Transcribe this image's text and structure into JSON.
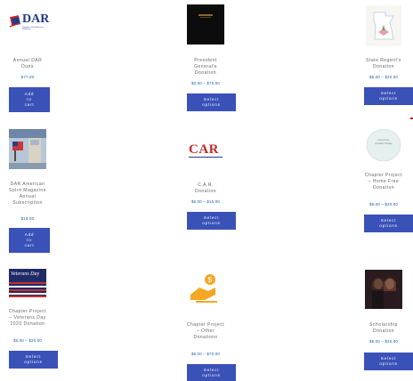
{
  "products": [
    {
      "title": "Annual DAR Dues",
      "price": "$77.00",
      "button": "Add to cart"
    },
    {
      "title": "President General's Donation",
      "price": "$2.50 – $70.00",
      "button": "Select options"
    },
    {
      "title": "State Regent's Donation",
      "price": "$5.00 – $20.00",
      "button": "Select options"
    },
    {
      "title": "DAR American Spirit Magazine Annual Subscription",
      "price": "$18.00",
      "button": "Add to cart"
    },
    {
      "title": "C.A.R. Donation",
      "price": "$5.00 – $15.00",
      "button": "Select options"
    },
    {
      "title": "Chapter Project – Home Free Donation",
      "price": "$5.00 – $20.00",
      "button": "Select options"
    },
    {
      "title": "Chapter Project – Veterans Day 2020 Donation",
      "price": "$5.00 – $20.00",
      "button": "Select options"
    },
    {
      "title": "Chapter Project – Other Donations",
      "price": "$5.00 – $70.00",
      "button": "Select options"
    },
    {
      "title": "Scholarship Donation",
      "price": "$5.00 – $20.00",
      "button": "Select options"
    }
  ],
  "logos": {
    "dar": "DAR",
    "dar_sub": "Daughters of the American Revolution",
    "car": "CAR",
    "veterans": "Veterans Day",
    "home_free": "Home Free Donation Pledge"
  },
  "colors": {
    "button": "#3a51b8",
    "price": "#1a5ca8",
    "title": "#666666"
  }
}
